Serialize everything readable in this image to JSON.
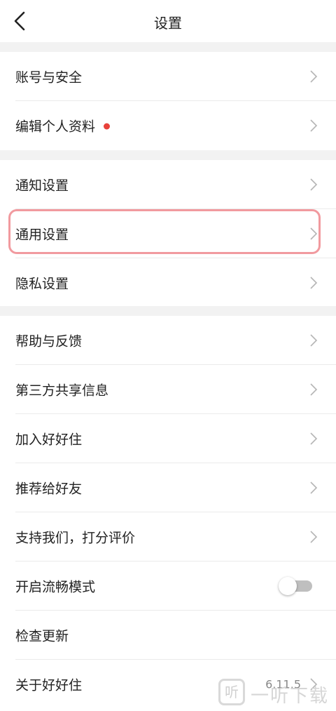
{
  "header": {
    "title": "设置"
  },
  "sections": {
    "account": [
      {
        "label": "账号与安全"
      },
      {
        "label": "编辑个人资料",
        "badge": true
      }
    ],
    "settings": [
      {
        "label": "通知设置"
      },
      {
        "label": "通用设置",
        "highlighted": true
      },
      {
        "label": "隐私设置"
      }
    ],
    "misc": [
      {
        "label": "帮助与反馈"
      },
      {
        "label": "第三方共享信息"
      },
      {
        "label": "加入好好住"
      },
      {
        "label": "推荐给好友"
      },
      {
        "label": "支持我们，打分评价"
      },
      {
        "label": "开启流畅模式",
        "toggle": false
      },
      {
        "label": "检查更新"
      },
      {
        "label": "关于好好住",
        "value": "6.11.5"
      }
    ]
  },
  "watermark": {
    "icon": "听",
    "text": "一听下载"
  },
  "colors": {
    "badge": "#e8413a",
    "highlight": "#f19a9f",
    "divider": "#ebebeb",
    "gap": "#f2f2f2"
  }
}
